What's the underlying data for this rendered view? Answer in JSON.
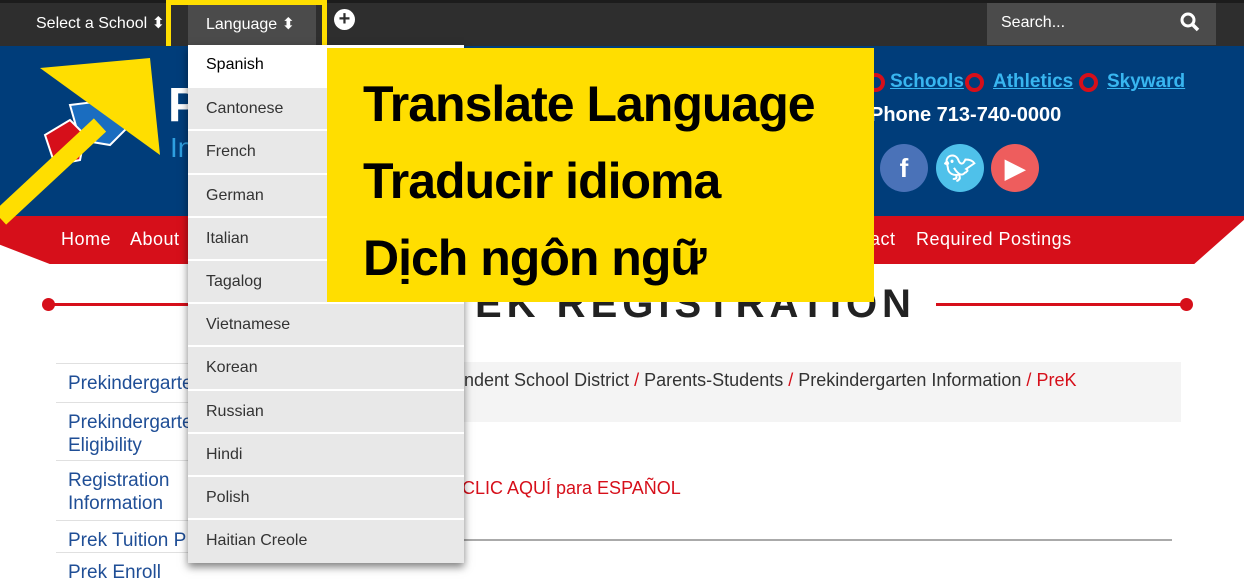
{
  "topbar": {
    "select_school": "Select a School",
    "language": "Language",
    "search_placeholder": "Search..."
  },
  "header": {
    "logo_letter": "P",
    "logo_sub": "In",
    "links": [
      "Schools",
      "Athletics",
      "Skyward"
    ],
    "phone": "Phone 713-740-0000"
  },
  "nav": {
    "items": [
      "Home",
      "About",
      "act",
      "Required Postings"
    ]
  },
  "page": {
    "title": "EK REGISTRATION",
    "sidebar": [
      "Prekindergarten",
      "Prekindergarten Eligibility Guidelines",
      "Registration Information",
      "Prek Tuition P",
      "Prek Enroll"
    ],
    "breadcrumb": [
      "endent School District",
      "Parents-Students",
      "Prekindergarten Information",
      "PreK"
    ],
    "breadcrumb_sep": "/",
    "clic": "CLIC AQUÍ para ESPAÑOL"
  },
  "dropdown": {
    "items": [
      "Spanish",
      "Cantonese",
      "French",
      "German",
      "Italian",
      "Tagalog",
      "Vietnamese",
      "Korean",
      "Russian",
      "Hindi",
      "Polish",
      "Haitian Creole"
    ]
  },
  "callout": {
    "lines": [
      "Translate Language",
      "Traducir idioma",
      "Dịch ngôn ngữ"
    ]
  },
  "colors": {
    "accent_yellow": "#ffde00",
    "header_blue": "#003d7a",
    "nav_red": "#d60f1a",
    "link_blue": "#38b6f0"
  }
}
